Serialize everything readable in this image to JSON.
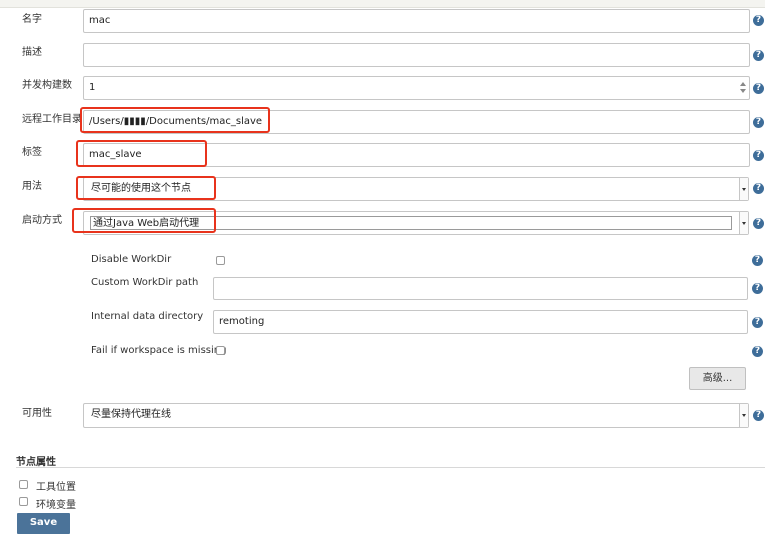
{
  "form": {
    "name": {
      "label": "名字",
      "value": "mac"
    },
    "description": {
      "label": "描述",
      "value": ""
    },
    "executors": {
      "label": "并发构建数",
      "value": "1"
    },
    "remote_root": {
      "label": "远程工作目录",
      "value": "/Users/▮▮▮▮/Documents/mac_slave"
    },
    "labels": {
      "label": "标签",
      "value": "mac_slave"
    },
    "usage": {
      "label": "用法",
      "value": "尽可能的使用这个节点"
    },
    "launch": {
      "label": "启动方式",
      "value": "通过Java Web启动代理"
    },
    "disable_workdir": {
      "label": "Disable WorkDir",
      "checked": false
    },
    "custom_workdir": {
      "label": "Custom WorkDir path",
      "value": ""
    },
    "internal_dir": {
      "label": "Internal data directory",
      "value": "remoting"
    },
    "fail_if_missing": {
      "label": "Fail if workspace is missing",
      "checked": false
    },
    "advanced_button": "高级...",
    "availability": {
      "label": "可用性",
      "value": "尽量保持代理在线"
    }
  },
  "node_properties": {
    "title": "节点属性",
    "items": [
      {
        "label": "工具位置",
        "checked": false
      },
      {
        "label": "环境变量",
        "checked": false
      }
    ]
  },
  "save_button": "Save",
  "help_glyph": "?",
  "colors": {
    "highlight": "#e8331c",
    "help": "#3e6d99",
    "save": "#4b7399"
  }
}
